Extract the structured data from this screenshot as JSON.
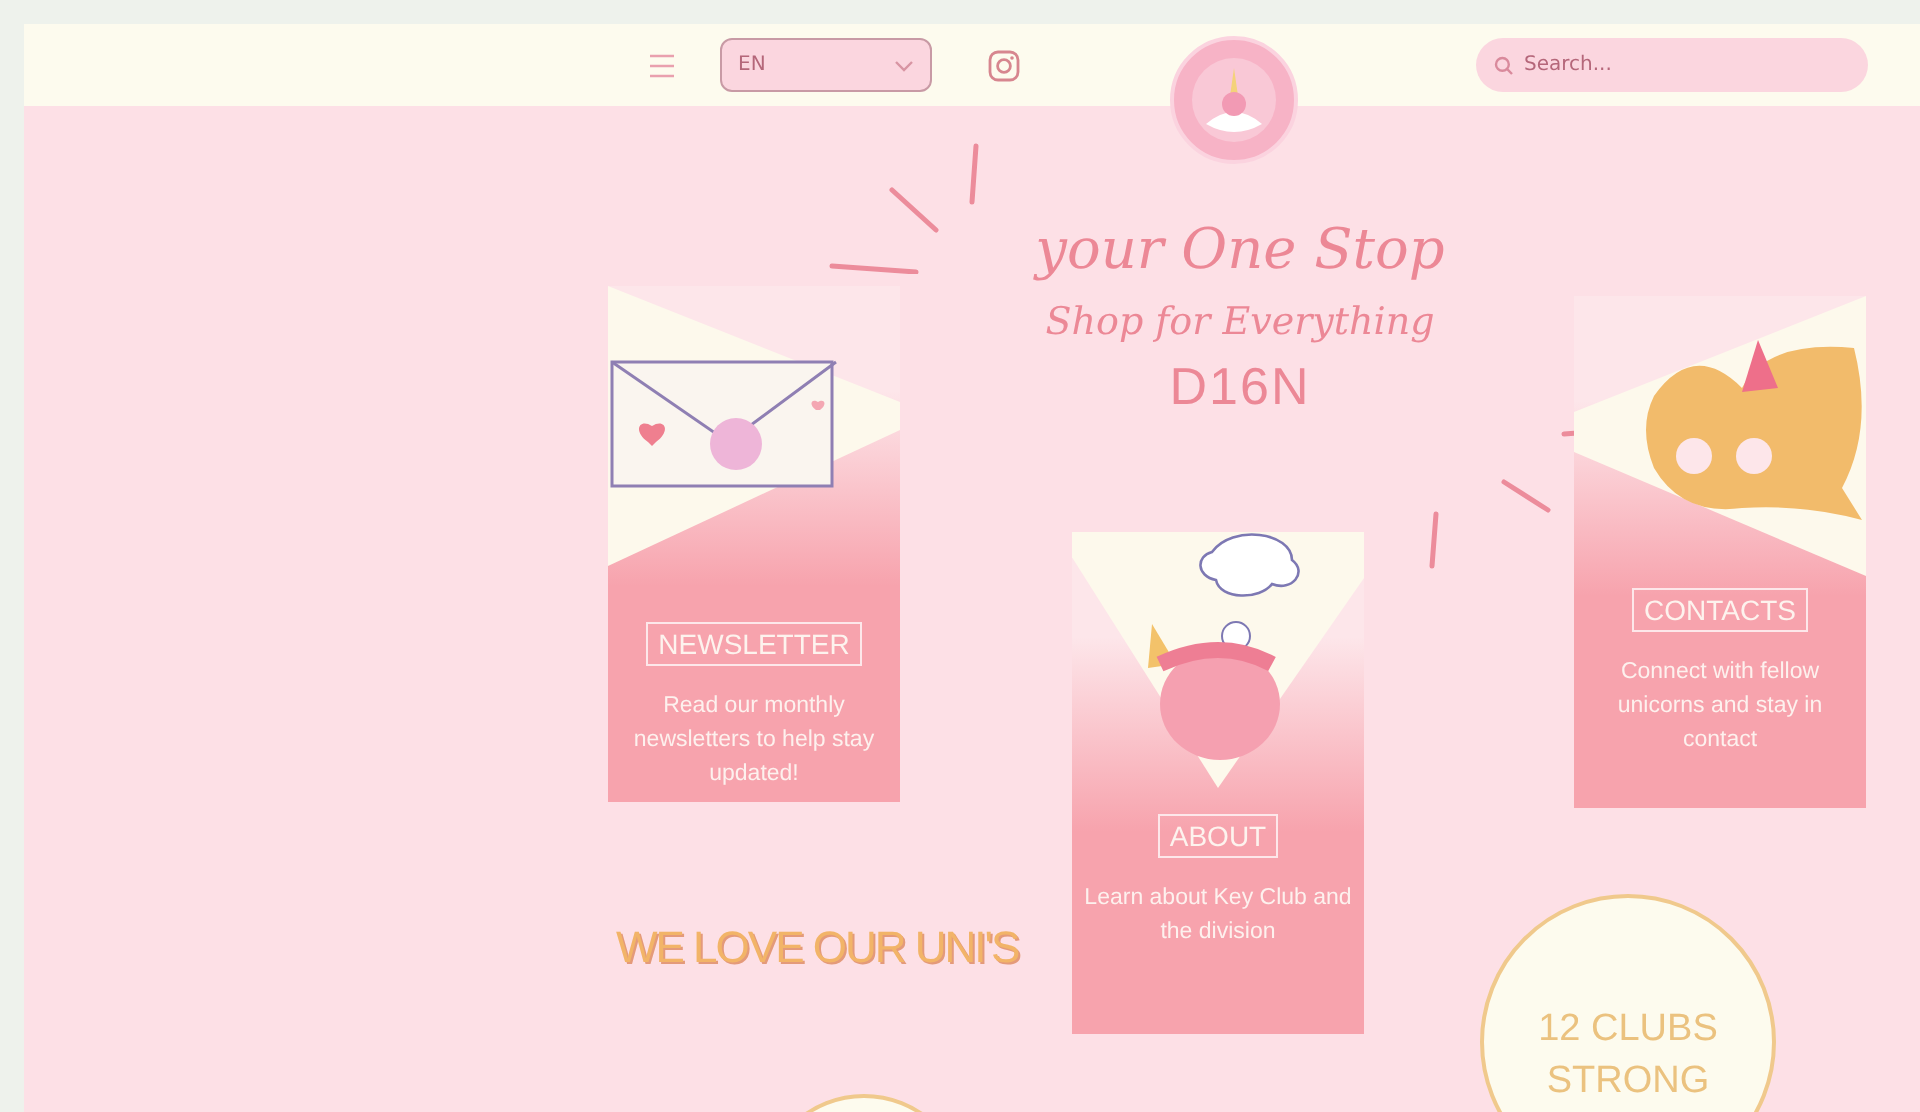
{
  "header": {
    "language": {
      "value": "EN"
    },
    "search": {
      "placeholder": "Search..."
    }
  },
  "hero": {
    "lines": [
      "your One Stop",
      "Shop for Everything",
      "D16N"
    ]
  },
  "cards": [
    {
      "kind": "envelope",
      "title": "NEWSLETTER",
      "text": "Read our monthly newsletters to help stay updated!"
    },
    {
      "kind": "unicorn",
      "title": "ABOUT",
      "text": "Learn about Key Club and the division"
    },
    {
      "kind": "chat",
      "title": "CONTACTS",
      "text": "Connect with fellow unicorns and stay in contact"
    }
  ],
  "tagline": "WE LOVE OUR UNI'S",
  "stats": [
    {
      "text": "12 CLUBS STRONG"
    }
  ]
}
